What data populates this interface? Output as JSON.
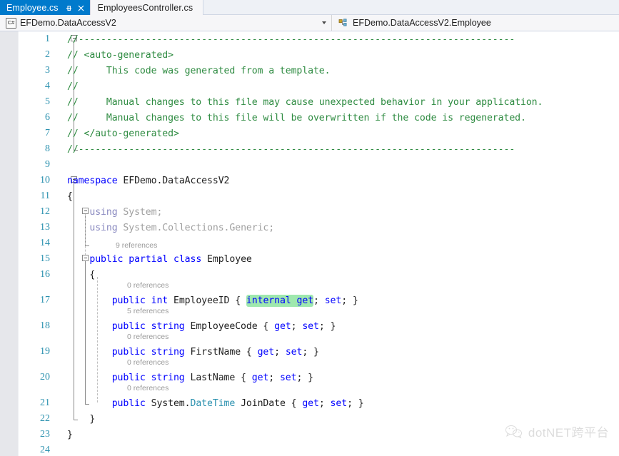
{
  "tabs": [
    {
      "label": "Employee.cs",
      "active": true,
      "pin_icon": "pin-icon",
      "close_icon": "close-icon"
    },
    {
      "label": "EmployeesController.cs",
      "active": false
    }
  ],
  "navbar": {
    "left": {
      "icon": "csharp-file-icon",
      "value": "EFDemo.DataAccessV2",
      "dropdown_icon": "chevron-down-icon"
    },
    "right": {
      "icon": "class-member-icon",
      "value": "EFDemo.DataAccessV2.Employee"
    }
  },
  "editor": {
    "lines": [
      {
        "no": "1",
        "code": "//------------------------------------------------------------------------------",
        "cls": "cmt"
      },
      {
        "no": "2",
        "code": "// <auto-generated>",
        "cls": "cmt"
      },
      {
        "no": "3",
        "code": "//     This code was generated from a template.",
        "cls": "cmt"
      },
      {
        "no": "4",
        "code": "//",
        "cls": "cmt"
      },
      {
        "no": "5",
        "code": "//     Manual changes to this file may cause unexpected behavior in your application.",
        "cls": "cmt"
      },
      {
        "no": "6",
        "code": "//     Manual changes to this file will be overwritten if the code is regenerated.",
        "cls": "cmt"
      },
      {
        "no": "7",
        "code": "// </auto-generated>",
        "cls": "cmt"
      },
      {
        "no": "8",
        "code": "//------------------------------------------------------------------------------",
        "cls": "cmt"
      },
      {
        "no": "9",
        "code": "",
        "cls": "plain"
      },
      {
        "no": "10",
        "code": "namespace EFDemo.DataAccessV2",
        "cls": "mixed"
      },
      {
        "no": "11",
        "code": "{",
        "cls": "plain"
      },
      {
        "no": "12",
        "code": "    using System;",
        "cls": "faded"
      },
      {
        "no": "13",
        "code": "    using System.Collections.Generic;",
        "cls": "faded"
      },
      {
        "no": "14",
        "code": "",
        "cls": "plain"
      },
      {
        "no": "15",
        "code": "    public partial class Employee",
        "cls": "mixed"
      },
      {
        "no": "16",
        "code": "    {",
        "cls": "plain"
      },
      {
        "no": "17",
        "code": "        public int EmployeeID { internal get; set; }",
        "cls": "mixed"
      },
      {
        "no": "18",
        "code": "        public string EmployeeCode { get; set; }",
        "cls": "mixed"
      },
      {
        "no": "19",
        "code": "        public string FirstName { get; set; }",
        "cls": "mixed"
      },
      {
        "no": "20",
        "code": "        public string LastName { get; set; }",
        "cls": "mixed"
      },
      {
        "no": "21",
        "code": "        public System.DateTime JoinDate { get; set; }",
        "cls": "mixed"
      },
      {
        "no": "22",
        "code": "    }",
        "cls": "plain"
      },
      {
        "no": "23",
        "code": "}",
        "cls": "plain"
      },
      {
        "no": "24",
        "code": "",
        "cls": "plain"
      }
    ],
    "codelens": [
      {
        "text": "9 references",
        "for_line": "15"
      },
      {
        "text": "0 references",
        "for_line": "17"
      },
      {
        "text": "5 references",
        "for_line": "18"
      },
      {
        "text": "0 references",
        "for_line": "19"
      },
      {
        "text": "0 references",
        "for_line": "20"
      },
      {
        "text": "0 references",
        "for_line": "21"
      }
    ],
    "highlighted_text": "internal get",
    "highlight_color": "#9fe8ae"
  },
  "watermark": {
    "text": "dotNET跨平台",
    "logo_icon": "wechat-logo-icon"
  },
  "colors": {
    "active_tab_bg": "#007acc",
    "comment_green": "#2e8b41",
    "keyword_blue": "#0000ff",
    "type_teal": "#2b91af",
    "linenumber_teal": "#2b91af"
  }
}
